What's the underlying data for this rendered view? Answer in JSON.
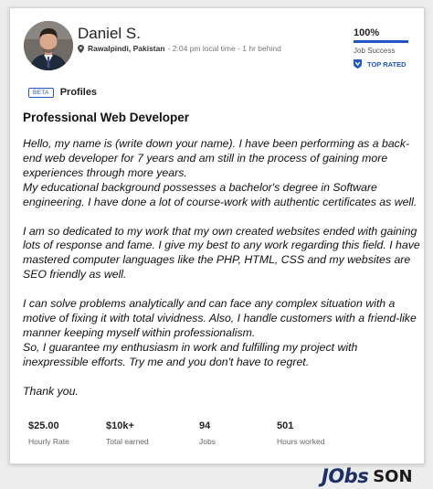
{
  "profile": {
    "name": "Daniel S.",
    "location": "Rawalpindi, Pakistan",
    "local_time": "- 2:04 pm local time - 1 hr behind",
    "job_success_value": "100%",
    "job_success_fraction": 1.0,
    "job_success_label": "Job Success",
    "top_rated_label": "TOP RATED"
  },
  "tabs": {
    "beta_label": "BETA",
    "profiles_label": "Profiles"
  },
  "title": "Professional Web Developer",
  "description": [
    "Hello, my name is (write down your name). I have been performing as a back-end web developer for 7 years and am still in the process of gaining more experiences through more years.",
    "My educational background possesses a bachelor's degree in Software engineering. I have done a lot of course-work with authentic certificates as well.",
    "I am so dedicated to my work that my own created websites ended with gaining lots of response and fame. I give my best to any work regarding this field. I have mastered computer languages like the PHP, HTML, CSS and my websites are SEO friendly as well.",
    "I can solve problems analytically and can face any complex situation with a motive of fixing it with total vividness. Also, I handle customers with a friend-like manner keeping myself within professionalism.",
    "So, I guarantee my enthusiasm in work and fulfilling my project with inexpressible efforts. Try me and you don't have to regret.",
    "Thank you."
  ],
  "stats": [
    {
      "value": "$25.00",
      "label": "Hourly Rate"
    },
    {
      "value": "$10k+",
      "label": "Total earned"
    },
    {
      "value": "94",
      "label": "Jobs"
    },
    {
      "value": "501",
      "label": "Hours worked"
    }
  ],
  "watermark": {
    "jobs": "JObs",
    "son": "SON"
  },
  "colors": {
    "accent": "#1f57c3",
    "logo_blue": "#1c2f6b"
  }
}
